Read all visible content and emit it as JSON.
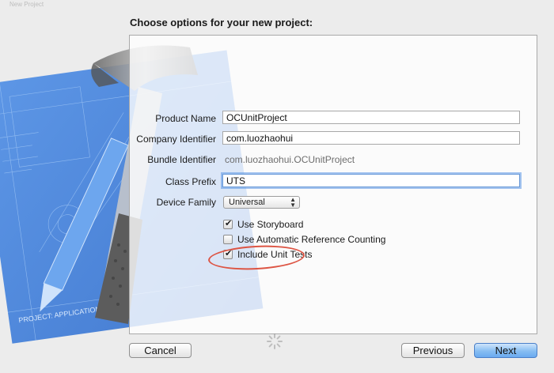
{
  "window": {
    "title": "New Project"
  },
  "heading": "Choose options for your new project:",
  "art": {
    "blueprint_labels": [
      "PROJECT: APPLICATION APP"
    ]
  },
  "form": {
    "product_name": {
      "label": "Product Name",
      "value": "OCUnitProject"
    },
    "company_identifier": {
      "label": "Company Identifier",
      "value": "com.luozhaohui"
    },
    "bundle_identifier": {
      "label": "Bundle Identifier",
      "value": "com.luozhaohui.OCUnitProject"
    },
    "class_prefix": {
      "label": "Class Prefix",
      "value": "UTS"
    },
    "device_family": {
      "label": "Device Family",
      "value": "Universal"
    },
    "options": [
      {
        "label": "Use Storyboard",
        "checked": true
      },
      {
        "label": "Use Automatic Reference Counting",
        "checked": false
      },
      {
        "label": "Include Unit Tests",
        "checked": true
      }
    ]
  },
  "buttons": {
    "cancel": "Cancel",
    "previous": "Previous",
    "next": "Next"
  },
  "colors": {
    "highlight": "#dd5544",
    "default_button": "#86bdf2",
    "blueprint": "#3f7fd8"
  }
}
